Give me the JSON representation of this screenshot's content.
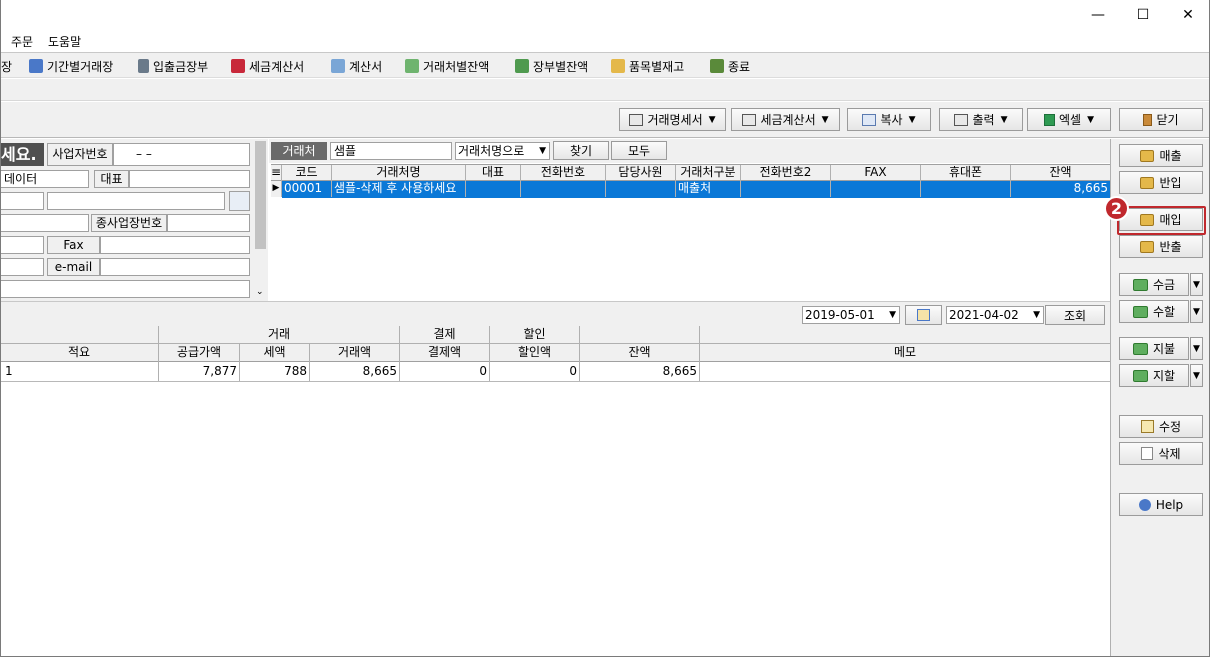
{
  "window": {
    "minimize_glyph": "—",
    "maximize_glyph": "☐",
    "close_glyph": "✕"
  },
  "menu": {
    "items": [
      "주문",
      "도움말"
    ]
  },
  "toolbar": {
    "items": [
      {
        "label": "장",
        "icon": "ledger-icon"
      },
      {
        "label": "기간별거래장",
        "icon": "period-ledger-icon"
      },
      {
        "label": "입출금장부",
        "icon": "calculator-icon"
      },
      {
        "label": "세금계산서",
        "icon": "tax-invoice-icon"
      },
      {
        "label": "계산서",
        "icon": "invoice-icon"
      },
      {
        "label": "거래처별잔액",
        "icon": "money-icon"
      },
      {
        "label": "장부별잔액",
        "icon": "money-icon"
      },
      {
        "label": "품목별재고",
        "icon": "box-icon"
      },
      {
        "label": "종료",
        "icon": "exit-icon"
      }
    ]
  },
  "actions": {
    "statement": "거래명세서",
    "tax_invoice": "세금계산서",
    "copy": "복사",
    "print": "출력",
    "excel": "엑셀",
    "close": "닫기"
  },
  "form": {
    "heading": "세요.",
    "biz_no_label": "사업자번호",
    "biz_no_value": "–    –",
    "data_value": "데이터",
    "ceo_label": "대표",
    "sub_biz_label": "종사업장번호",
    "fax_label": "Fax",
    "email_label": "e-mail"
  },
  "search": {
    "label": "거래처",
    "value": "샘플",
    "mode": "거래처명으로",
    "find": "찾기",
    "all": "모두"
  },
  "grid": {
    "columns": [
      "코드",
      "거래처명",
      "대표",
      "전화번호",
      "담당사원",
      "거래처구분",
      "전화번호2",
      "FAX",
      "휴대폰",
      "잔액"
    ],
    "rows": [
      {
        "code": "00001",
        "name": "샘플-삭제 후 사용하세요",
        "ceo": "",
        "phone": "",
        "staff": "",
        "type": "매출처",
        "phone2": "",
        "fax": "",
        "mobile": "",
        "balance": "8,665"
      }
    ]
  },
  "dates": {
    "from": "2019-05-01",
    "to": "2021-04-02",
    "query": "조회"
  },
  "ledger": {
    "group_trade": "거래",
    "group_payment": "결제",
    "group_discount": "할인",
    "columns": [
      "적요",
      "공급가액",
      "세액",
      "거래액",
      "결제액",
      "할인액",
      "잔액",
      "메모"
    ],
    "rows": [
      {
        "memo_summary": "1",
        "supply": "7,877",
        "tax": "788",
        "trade": "8,665",
        "payment": "0",
        "discount": "0",
        "balance": "8,665",
        "memo": ""
      }
    ]
  },
  "side": {
    "sales": "매출",
    "sales_return": "반입",
    "purchase": "매입",
    "purchase_return": "반출",
    "receive": "수금",
    "receive_discount": "수할",
    "pay": "지불",
    "pay_discount": "지할",
    "edit": "수정",
    "delete": "삭제",
    "help": "Help"
  },
  "annotation": {
    "step": "2",
    "color": "#c0282d"
  }
}
